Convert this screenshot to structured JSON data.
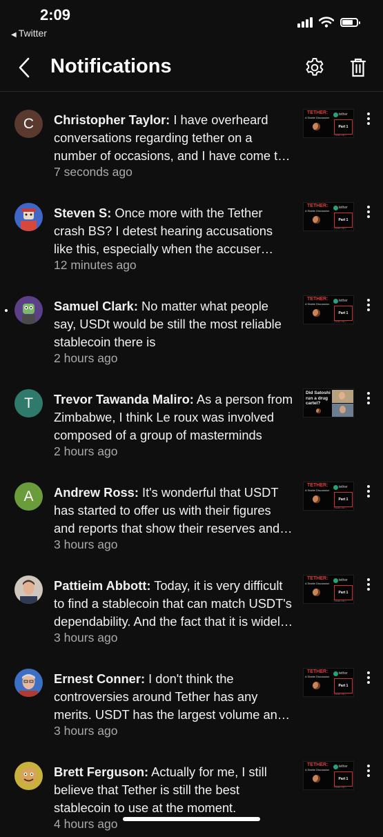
{
  "status_bar": {
    "time": "2:09",
    "back_app": "Twitter"
  },
  "header": {
    "title": "Notifications"
  },
  "notifications": [
    {
      "name": "Christopher Taylor:",
      "text": " I have overheard conversations regarding tether on a number of occasions, and I have come to the conclusion that",
      "ago": "7 seconds ago",
      "avatar_letter": "C",
      "avatar_color": "#5a3a2e",
      "thumb": "tether"
    },
    {
      "name": "Steven S:",
      "text": " Once more with the Tether crash BS? I detest hearing accusations like this, especially when the accuser offers no proof",
      "ago": "12 minutes ago",
      "avatar_letter": "",
      "avatar_color": "#3f67c8",
      "thumb": "tether"
    },
    {
      "name": "Samuel Clark:",
      "text": " No matter what people say, USDt would be still the most reliable stablecoin there is",
      "ago": "2 hours ago",
      "avatar_letter": "",
      "avatar_color": "#5b3f87",
      "thumb": "tether",
      "unread": true
    },
    {
      "name": "Trevor Tawanda Maliro:",
      "text": " As a person from Zimbabwe, I think Le roux was involved composed of a group of masterminds",
      "ago": "2 hours ago",
      "avatar_letter": "T",
      "avatar_color": "#2f7a6a",
      "thumb": "drug"
    },
    {
      "name": "Andrew Ross:",
      "text": " It's wonderful that USDT has started to offer us with their  figures and reports that show their reserves and holdings",
      "ago": "3 hours ago",
      "avatar_letter": "A",
      "avatar_color": "#6a9c3b",
      "thumb": "tether"
    },
    {
      "name": "Pattieim Abbott:",
      "text": " Today, it is very difficult to find a stablecoin that can match USDT's dependability. And the fact that it is widely used",
      "ago": "3 hours ago",
      "avatar_letter": "",
      "avatar_color": "#cfc6bd",
      "thumb": "tether"
    },
    {
      "name": "Ernest Conner:",
      "text": " I don't think the controversies around Tether has any merits.  USDT has the largest volume and liquidity",
      "ago": "3 hours ago",
      "avatar_letter": "",
      "avatar_color": "#3d6fc4",
      "thumb": "tether"
    },
    {
      "name": "Brett Ferguson:",
      "text": " Actually for me, I still believe that Tether is still the best stablecoin to use at the moment.",
      "ago": "4 hours ago",
      "avatar_letter": "",
      "avatar_color": "#c9b13e",
      "thumb": "tether"
    }
  ],
  "thumbnail_tether": {
    "title": "TETHER:",
    "subtitle": "A Stable Discussion",
    "brand": "tether",
    "part": "Part 1",
    "note": "( Audio only )"
  },
  "thumbnail_drug": {
    "question": "Did Satoshi run a drug cartel?"
  }
}
